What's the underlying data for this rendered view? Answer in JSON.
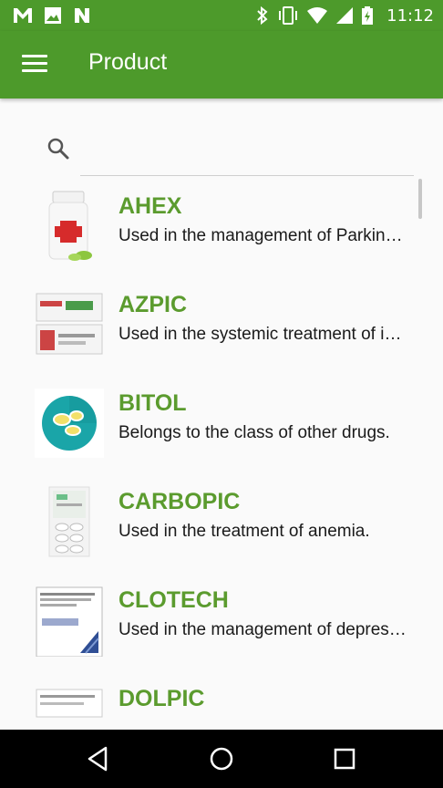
{
  "status_bar": {
    "time": "11:12",
    "left_icons": [
      "gmail-icon",
      "image-icon",
      "notification-n-icon"
    ],
    "right_icons": [
      "bluetooth-icon",
      "vibrate-icon",
      "wifi-icon",
      "signal-icon",
      "battery-charging-icon"
    ]
  },
  "app_bar": {
    "title": "Product",
    "menu_icon": "hamburger-menu-icon",
    "background_color": "#4d9a2b"
  },
  "search": {
    "placeholder": "",
    "value": "",
    "icon": "search-icon"
  },
  "products": [
    {
      "name": "AHEX",
      "description": "Used in the management of Parkinson's disease.",
      "thumbnail": "medicine-bottle-icon"
    },
    {
      "name": "AZPIC",
      "description": "Used in the systemic treatment of infections.",
      "thumbnail": "tablet-strip-box-icon"
    },
    {
      "name": "BITOL",
      "description": "Belongs to the class of other drugs.",
      "thumbnail": "pills-circle-icon"
    },
    {
      "name": "CARBOPIC",
      "description": "Used in the treatment of anemia.",
      "thumbnail": "blister-pack-icon"
    },
    {
      "name": "CLOTECH",
      "description": "Used in the management of depression.",
      "thumbnail": "medicine-box-icon"
    },
    {
      "name": "DOLPIC",
      "description": "",
      "thumbnail": "injection-box-icon"
    }
  ],
  "colors": {
    "primary": "#4d9a2b",
    "product_name": "#5b9b2e"
  },
  "nav_bar": {
    "buttons": [
      "back-icon",
      "home-icon",
      "recents-icon"
    ]
  }
}
